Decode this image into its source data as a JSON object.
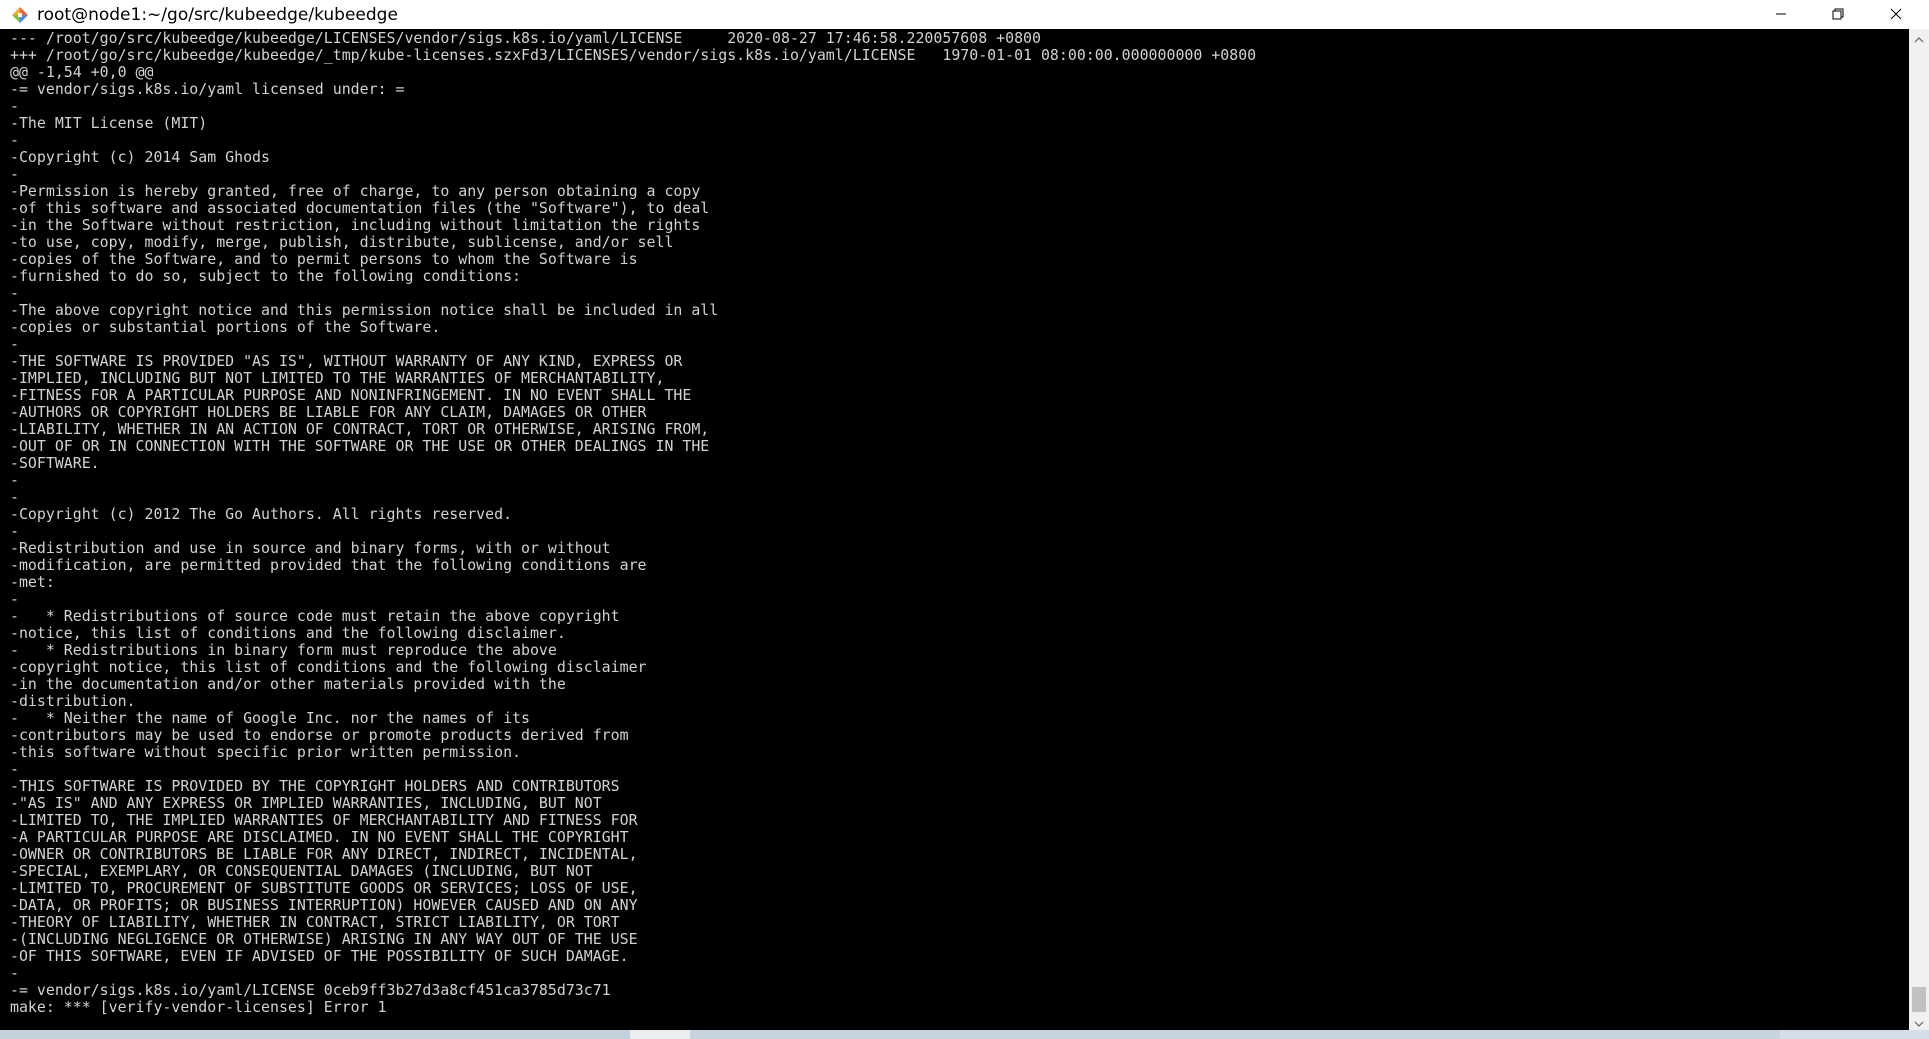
{
  "window": {
    "title": "root@node1:~/go/src/kubeedge/kubeedge"
  },
  "titlebar_buttons": {
    "minimize": "minimize-icon",
    "maximize": "restore-icon",
    "close": "close-icon"
  },
  "terminal": {
    "output": "--- /root/go/src/kubeedge/kubeedge/LICENSES/vendor/sigs.k8s.io/yaml/LICENSE     2020-08-27 17:46:58.220057608 +0800\n+++ /root/go/src/kubeedge/kubeedge/_tmp/kube-licenses.szxFd3/LICENSES/vendor/sigs.k8s.io/yaml/LICENSE   1970-01-01 08:00:00.000000000 +0800\n@@ -1,54 +0,0 @@\n-= vendor/sigs.k8s.io/yaml licensed under: =\n-\n-The MIT License (MIT)\n-\n-Copyright (c) 2014 Sam Ghods\n-\n-Permission is hereby granted, free of charge, to any person obtaining a copy\n-of this software and associated documentation files (the \"Software\"), to deal\n-in the Software without restriction, including without limitation the rights\n-to use, copy, modify, merge, publish, distribute, sublicense, and/or sell\n-copies of the Software, and to permit persons to whom the Software is\n-furnished to do so, subject to the following conditions:\n-\n-The above copyright notice and this permission notice shall be included in all\n-copies or substantial portions of the Software.\n-\n-THE SOFTWARE IS PROVIDED \"AS IS\", WITHOUT WARRANTY OF ANY KIND, EXPRESS OR\n-IMPLIED, INCLUDING BUT NOT LIMITED TO THE WARRANTIES OF MERCHANTABILITY,\n-FITNESS FOR A PARTICULAR PURPOSE AND NONINFRINGEMENT. IN NO EVENT SHALL THE\n-AUTHORS OR COPYRIGHT HOLDERS BE LIABLE FOR ANY CLAIM, DAMAGES OR OTHER\n-LIABILITY, WHETHER IN AN ACTION OF CONTRACT, TORT OR OTHERWISE, ARISING FROM,\n-OUT OF OR IN CONNECTION WITH THE SOFTWARE OR THE USE OR OTHER DEALINGS IN THE\n-SOFTWARE.\n-\n-\n-Copyright (c) 2012 The Go Authors. All rights reserved.\n-\n-Redistribution and use in source and binary forms, with or without\n-modification, are permitted provided that the following conditions are\n-met:\n-\n-   * Redistributions of source code must retain the above copyright\n-notice, this list of conditions and the following disclaimer.\n-   * Redistributions in binary form must reproduce the above\n-copyright notice, this list of conditions and the following disclaimer\n-in the documentation and/or other materials provided with the\n-distribution.\n-   * Neither the name of Google Inc. nor the names of its\n-contributors may be used to endorse or promote products derived from\n-this software without specific prior written permission.\n-\n-THIS SOFTWARE IS PROVIDED BY THE COPYRIGHT HOLDERS AND CONTRIBUTORS\n-\"AS IS\" AND ANY EXPRESS OR IMPLIED WARRANTIES, INCLUDING, BUT NOT\n-LIMITED TO, THE IMPLIED WARRANTIES OF MERCHANTABILITY AND FITNESS FOR\n-A PARTICULAR PURPOSE ARE DISCLAIMED. IN NO EVENT SHALL THE COPYRIGHT\n-OWNER OR CONTRIBUTORS BE LIABLE FOR ANY DIRECT, INDIRECT, INCIDENTAL,\n-SPECIAL, EXEMPLARY, OR CONSEQUENTIAL DAMAGES (INCLUDING, BUT NOT\n-LIMITED TO, PROCUREMENT OF SUBSTITUTE GOODS OR SERVICES; LOSS OF USE,\n-DATA, OR PROFITS; OR BUSINESS INTERRUPTION) HOWEVER CAUSED AND ON ANY\n-THEORY OF LIABILITY, WHETHER IN CONTRACT, STRICT LIABILITY, OR TORT\n-(INCLUDING NEGLIGENCE OR OTHERWISE) ARISING IN ANY WAY OUT OF THE USE\n-OF THIS SOFTWARE, EVEN IF ADVISED OF THE POSSIBILITY OF SUCH DAMAGE.\n-\n-= vendor/sigs.k8s.io/yaml/LICENSE 0ceb9ff3b27d3a8cf451ca3785d73c71\nmake: *** [verify-vendor-licenses] Error 1",
    "text_color": "#d2d2d2",
    "background": "#000000"
  },
  "scrollbar": {
    "up_icon": "scroll-up-arrow-icon",
    "down_icon": "scroll-down-arrow-icon",
    "position": 0.97
  }
}
